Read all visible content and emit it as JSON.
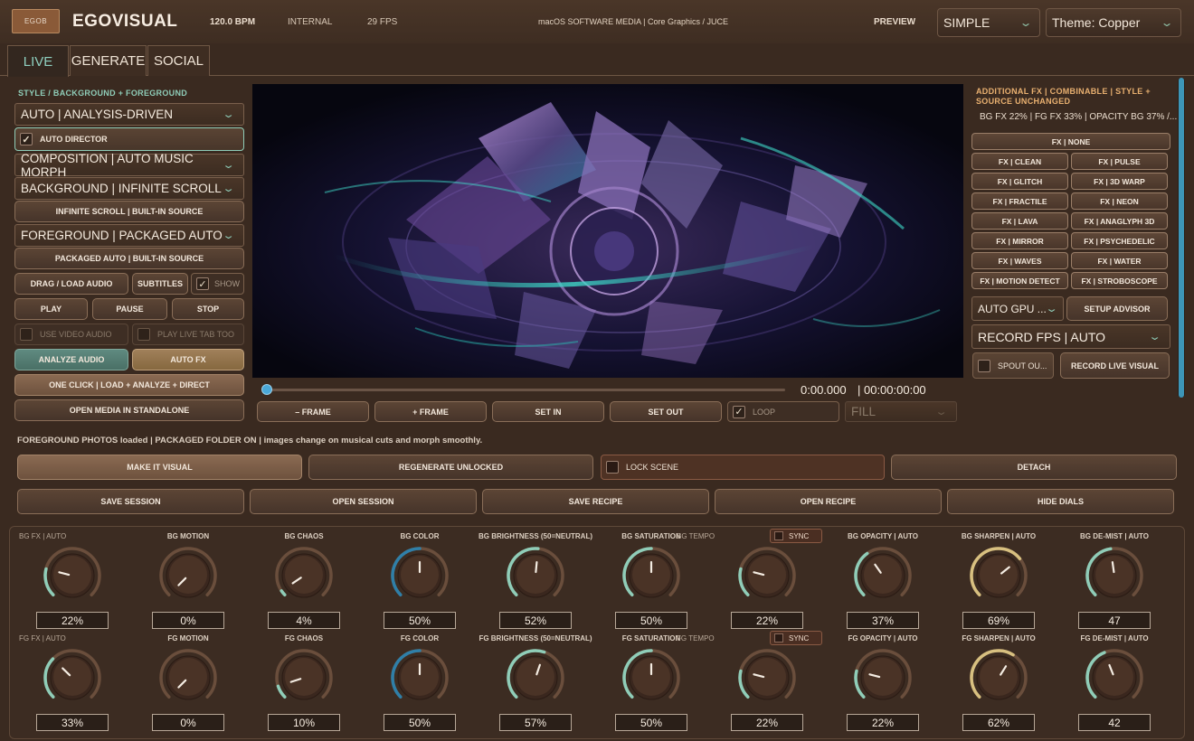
{
  "header": {
    "logo": "EGOB",
    "brand": "EGOVISUAL",
    "bpm": "120.0 BPM",
    "clock": "INTERNAL",
    "fps": "29 FPS",
    "platform": "macOS SOFTWARE MEDIA | Core Graphics / JUCE",
    "preview_label": "PREVIEW",
    "mode_value": "SIMPLE",
    "theme_value": "Theme: Copper"
  },
  "tabs": [
    {
      "label": "LIVE",
      "active": true
    },
    {
      "label": "GENERATE",
      "active": false
    },
    {
      "label": "SOCIAL",
      "active": false
    }
  ],
  "left": {
    "section_label": "STYLE / BACKGROUND + FOREGROUND",
    "style_select": "AUTO | ANALYSIS-DRIVEN",
    "auto_director": "AUTO DIRECTOR",
    "composition_select": "COMPOSITION | AUTO MUSIC MORPH",
    "background_select": "BACKGROUND | INFINITE SCROLL",
    "bg_source_button": "INFINITE SCROLL | BUILT-IN SOURCE",
    "foreground_select": "FOREGROUND | PACKAGED AUTO",
    "fg_source_button": "PACKAGED AUTO | BUILT-IN SOURCE",
    "drag_load_audio": "DRAG / LOAD AUDIO",
    "subtitles": "SUBTITLES",
    "show": "SHOW",
    "play": "PLAY",
    "pause": "PAUSE",
    "stop": "STOP",
    "use_video_audio": "USE VIDEO AUDIO",
    "play_live_tab_too": "PLAY LIVE TAB TOO",
    "analyze_audio": "ANALYZE AUDIO",
    "auto_fx": "AUTO FX",
    "one_click": "ONE CLICK | LOAD + ANALYZE + DIRECT",
    "open_media_standalone": "OPEN MEDIA IN STANDALONE"
  },
  "transport": {
    "time_current": "0:00.000",
    "time_total": "| 00:00:00:00",
    "minus_frame": "– FRAME",
    "plus_frame": "+ FRAME",
    "set_in": "SET IN",
    "set_out": "SET OUT",
    "loop": "LOOP",
    "fit_mode": "FILL",
    "progress": 0
  },
  "right": {
    "section_label": "ADDITIONAL FX | COMBINABLE | STYLE + SOURCE UNCHANGED",
    "summary": "BG FX 22% | FG FX 33% | OPACITY BG 37% /...",
    "fx_none": "FX | NONE",
    "fx_buttons": [
      "FX | CLEAN",
      "FX | PULSE",
      "FX | GLITCH",
      "FX | 3D WARP",
      "FX | FRACTILE",
      "FX | NEON",
      "FX | LAVA",
      "FX | ANAGLYPH 3D",
      "FX | MIRROR",
      "FX | PSYCHEDELIC",
      "FX | WAVES",
      "FX | WATER",
      "FX | MOTION DETECT",
      "FX | STROBOSCOPE"
    ],
    "gpu_select": "AUTO GPU ...",
    "setup_advisor": "SETUP ADVISOR",
    "record_fps_select": "RECORD FPS | AUTO",
    "spout_output": "SPOUT OU...",
    "record_live_visual": "RECORD LIVE VISUAL"
  },
  "status": "FOREGROUND PHOTOS loaded | PACKAGED FOLDER ON | images change on musical cuts and morph smoothly.",
  "actions": {
    "make_it_visual": "MAKE IT VISUAL",
    "regenerate_unlocked": "REGENERATE UNLOCKED",
    "lock_scene": "LOCK SCENE",
    "detach": "DETACH",
    "save_session": "SAVE SESSION",
    "open_session": "OPEN SESSION",
    "save_recipe": "SAVE RECIPE",
    "open_recipe": "OPEN RECIPE",
    "hide_dials": "HIDE DIALS"
  },
  "sync_label": "SYNC",
  "dials": {
    "bg": [
      {
        "label": "BG FX | AUTO",
        "value": "22%",
        "level": 0.22,
        "dim": true
      },
      {
        "label": "BG MOTION",
        "value": "0%",
        "level": 0.0
      },
      {
        "label": "BG CHAOS",
        "value": "4%",
        "level": 0.04
      },
      {
        "label": "BG COLOR",
        "value": "50%",
        "level": 0.5,
        "ring": "blue"
      },
      {
        "label": "BG BRIGHTNESS (50=NEUTRAL)",
        "value": "52%",
        "level": 0.52
      },
      {
        "label": "BG SATURATION",
        "value": "50%",
        "level": 0.5
      },
      {
        "label": "BG TEMPO",
        "value": "22%",
        "level": 0.22,
        "dim": true,
        "sync": true
      },
      {
        "label": "BG OPACITY | AUTO",
        "value": "37%",
        "level": 0.37
      },
      {
        "label": "BG SHARPEN | AUTO",
        "value": "69%",
        "level": 0.69,
        "ring": "yellow"
      },
      {
        "label": "BG DE-MIST | AUTO",
        "value": "47",
        "level": 0.47
      }
    ],
    "fg": [
      {
        "label": "FG FX | AUTO",
        "value": "33%",
        "level": 0.33,
        "dim": true
      },
      {
        "label": "FG MOTION",
        "value": "0%",
        "level": 0.0
      },
      {
        "label": "FG CHAOS",
        "value": "10%",
        "level": 0.1
      },
      {
        "label": "FG COLOR",
        "value": "50%",
        "level": 0.5,
        "ring": "blue"
      },
      {
        "label": "FG BRIGHTNESS (50=NEUTRAL)",
        "value": "57%",
        "level": 0.57
      },
      {
        "label": "FG SATURATION",
        "value": "50%",
        "level": 0.5
      },
      {
        "label": "FG TEMPO",
        "value": "22%",
        "level": 0.22,
        "dim": true,
        "sync": true
      },
      {
        "label": "FG OPACITY | AUTO",
        "value": "22%",
        "level": 0.22
      },
      {
        "label": "FG SHARPEN | AUTO",
        "value": "62%",
        "level": 0.62,
        "ring": "yellow"
      },
      {
        "label": "FG DE-MIST | AUTO",
        "value": "42",
        "level": 0.42
      }
    ]
  },
  "colors": {
    "accent_green": "#8fcdb8",
    "accent_blue": "#3d96b8",
    "copper": "#3a2a20"
  }
}
